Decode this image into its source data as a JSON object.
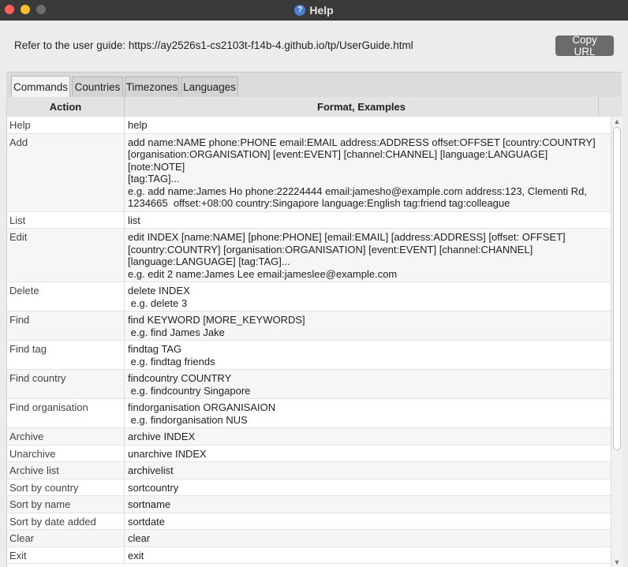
{
  "window": {
    "title": "Help",
    "help_glyph": "?"
  },
  "url_bar": {
    "text": "Refer to the user guide: https://ay2526s1-cs2103t-f14b-4.github.io/tp/UserGuide.html",
    "copy_label": "Copy URL"
  },
  "tabs": [
    {
      "label": "Commands",
      "active": true
    },
    {
      "label": "Countries",
      "active": false
    },
    {
      "label": "Timezones",
      "active": false
    },
    {
      "label": "Languages",
      "active": false
    }
  ],
  "table": {
    "headers": [
      "Action",
      "Format, Examples"
    ],
    "rows": [
      {
        "action": "Help",
        "format": "help"
      },
      {
        "action": "Add",
        "format": "add name:NAME phone:PHONE email:EMAIL address:ADDRESS offset:OFFSET [country:COUNTRY]\n[organisation:ORGANISATION] [event:EVENT] [channel:CHANNEL] [language:LANGUAGE] [note:NOTE]\n[tag:TAG]...\ne.g. add name:James Ho phone:22224444 email:jamesho@example.com address:123, Clementi Rd,\n1234665  offset:+08:00 country:Singapore language:English tag:friend tag:colleague"
      },
      {
        "action": "List",
        "format": "list"
      },
      {
        "action": "Edit",
        "format": "edit INDEX [name:NAME] [phone:PHONE] [email:EMAIL] [address:ADDRESS] [offset: OFFSET]\n[country:COUNTRY] [organisation:ORGANISATION] [event:EVENT] [channel:CHANNEL]\n[language:LANGUAGE] [tag:TAG]...\ne.g. edit 2 name:James Lee email:jameslee@example.com"
      },
      {
        "action": "Delete",
        "format": "delete INDEX\n e.g. delete 3"
      },
      {
        "action": "Find",
        "format": "find KEYWORD [MORE_KEYWORDS]\n e.g. find James Jake"
      },
      {
        "action": "Find tag",
        "format": "findtag TAG\n e.g. findtag friends"
      },
      {
        "action": "Find country",
        "format": "findcountry COUNTRY\n e.g. findcountry Singapore"
      },
      {
        "action": "Find organisation",
        "format": "findorganisation ORGANISAION\n e.g. findorganisation NUS"
      },
      {
        "action": "Archive",
        "format": "archive INDEX"
      },
      {
        "action": "Unarchive",
        "format": "unarchive INDEX"
      },
      {
        "action": "Archive list",
        "format": "archivelist"
      },
      {
        "action": "Sort by country",
        "format": "sortcountry"
      },
      {
        "action": "Sort by name",
        "format": "sortname"
      },
      {
        "action": "Sort by date added",
        "format": "sortdate"
      },
      {
        "action": "Clear",
        "format": "clear"
      },
      {
        "action": "Exit",
        "format": "exit"
      }
    ]
  },
  "colors": {
    "titlebar": "#3a3a3a",
    "close": "#ff5f57",
    "minimize": "#febc2e",
    "button": "#6b6b6b"
  }
}
